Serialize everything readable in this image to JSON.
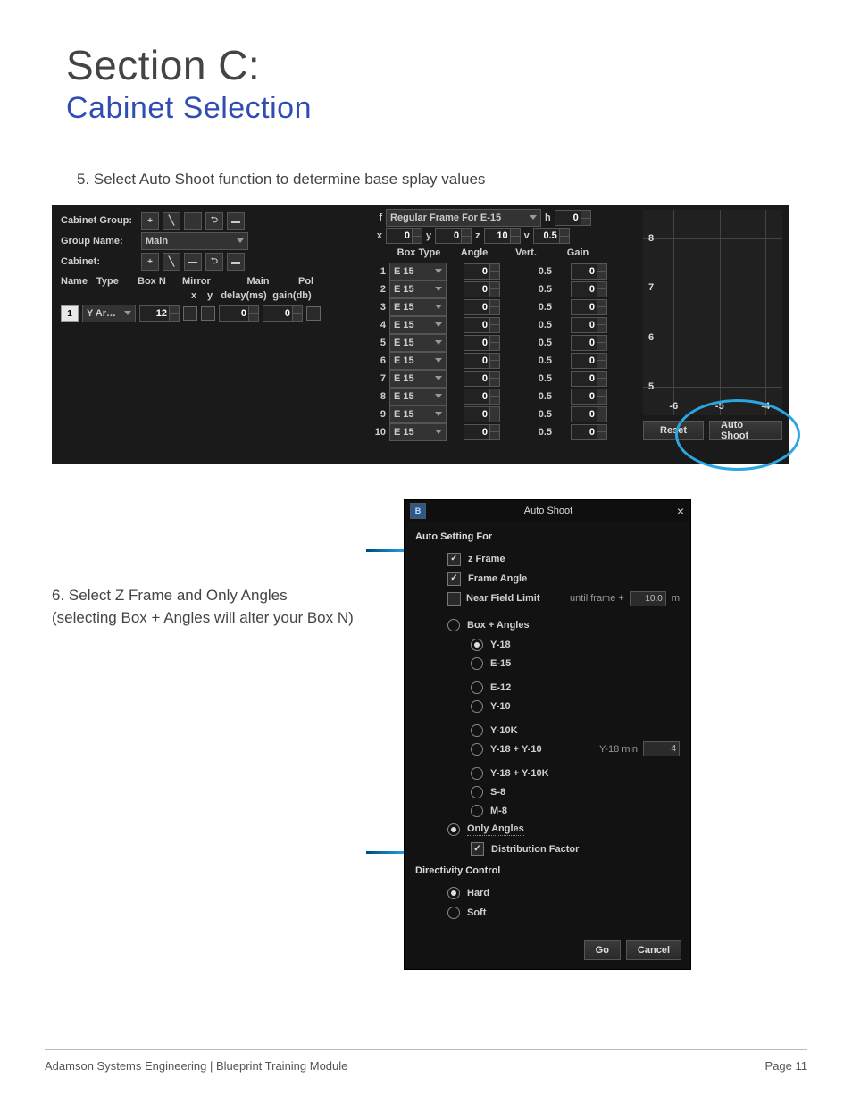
{
  "doc": {
    "section_label": "Section C:",
    "section_title": "Cabinet Selection",
    "step5": "5. Select Auto Shoot function to determine base splay values",
    "step6_line1": "6. Select Z Frame and Only Angles",
    "step6_line2": "(selecting Box + Angles will alter your Box N)",
    "footer_left": "Adamson Systems Engineering  |  Blueprint Training Module",
    "footer_right": "Page 11"
  },
  "panelA": {
    "left": {
      "cabinet_group_label": "Cabinet Group:",
      "group_name_label": "Group Name:",
      "group_name_value": "Main",
      "cabinet_label": "Cabinet:",
      "col_name": "Name",
      "col_type": "Type",
      "col_boxn": "Box N",
      "col_mirror": "Mirror",
      "col_main": "Main",
      "col_pol": "Pol",
      "sub_x": "x",
      "sub_y": "y",
      "sub_delay": "delay(ms)",
      "sub_gain": "gain(db)",
      "row_idx": "1",
      "row_type": "Y Ar…",
      "row_boxn": "12",
      "row_delay": "0",
      "row_gain": "0"
    },
    "mid": {
      "f": "f",
      "frame_label": "Regular Frame For E-15",
      "h": "h",
      "h_val": "0",
      "x": "x",
      "x_val": "0",
      "y": "y",
      "y_val": "0",
      "z": "z",
      "z_val": "10",
      "v": "v",
      "v_val": "0.5",
      "hdr_box": "Box Type",
      "hdr_angle": "Angle",
      "hdr_vert": "Vert.",
      "hdr_gain": "Gain",
      "rows": [
        {
          "n": "1",
          "box": "E 15",
          "angle": "0",
          "vert": "0.5",
          "gain": "0"
        },
        {
          "n": "2",
          "box": "E 15",
          "angle": "0",
          "vert": "0.5",
          "gain": "0"
        },
        {
          "n": "3",
          "box": "E 15",
          "angle": "0",
          "vert": "0.5",
          "gain": "0"
        },
        {
          "n": "4",
          "box": "E 15",
          "angle": "0",
          "vert": "0.5",
          "gain": "0"
        },
        {
          "n": "5",
          "box": "E 15",
          "angle": "0",
          "vert": "0.5",
          "gain": "0"
        },
        {
          "n": "6",
          "box": "E 15",
          "angle": "0",
          "vert": "0.5",
          "gain": "0"
        },
        {
          "n": "7",
          "box": "E 15",
          "angle": "0",
          "vert": "0.5",
          "gain": "0"
        },
        {
          "n": "8",
          "box": "E 15",
          "angle": "0",
          "vert": "0.5",
          "gain": "0"
        },
        {
          "n": "9",
          "box": "E 15",
          "angle": "0",
          "vert": "0.5",
          "gain": "0"
        },
        {
          "n": "10",
          "box": "E 15",
          "angle": "0",
          "vert": "0.5",
          "gain": "0"
        }
      ]
    },
    "right": {
      "yticks": [
        "8",
        "7",
        "6",
        "5"
      ],
      "xticks": [
        "-6",
        "-5",
        "-4"
      ],
      "reset": "Reset",
      "autoshoot": "Auto Shoot"
    }
  },
  "panelB": {
    "title": "Auto Shoot",
    "heading": "Auto Setting For",
    "z_frame": "z Frame",
    "frame_angle": "Frame Angle",
    "near_field": "Near Field Limit",
    "until_frame": "until frame +",
    "until_frame_val": "10.0",
    "m": "m",
    "box_plus": "Box + Angles",
    "options": [
      "Y-18",
      "E-15",
      "E-12",
      "Y-10",
      "Y-10K",
      "Y-18 + Y-10",
      "Y-18 + Y-10K",
      "S-8",
      "M-8"
    ],
    "y18_min_label": "Y-18 min",
    "y18_min_val": "4",
    "only_angles": "Only Angles",
    "dist_factor": "Distribution Factor",
    "directivity": "Directivity Control",
    "hard": "Hard",
    "soft": "Soft",
    "go": "Go",
    "cancel": "Cancel"
  },
  "chart_data": {
    "type": "line",
    "x": [],
    "y": [],
    "xlim": [
      -6.5,
      -3.5
    ],
    "ylim": [
      4.5,
      8.5
    ],
    "xticks": [
      -6,
      -5,
      -4
    ],
    "yticks": [
      5,
      6,
      7,
      8
    ],
    "title": "",
    "xlabel": "",
    "ylabel": ""
  }
}
